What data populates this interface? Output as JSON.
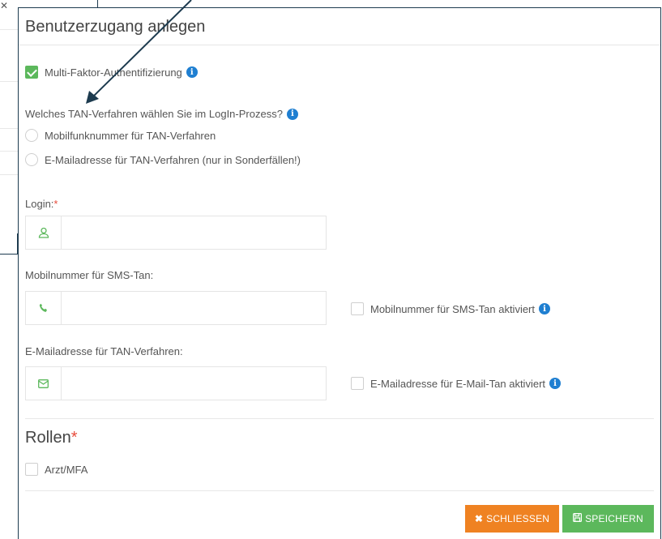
{
  "dialog": {
    "title": "Benutzerzugang anlegen",
    "mfa": {
      "label": "Multi-Faktor-Authentifizierung",
      "checked": true,
      "info_icon": "info-circle-icon"
    },
    "tan_question": "Welches TAN-Verfahren wählen Sie im LogIn-Prozess?",
    "tan_options": [
      {
        "label": "Mobilfunknummer für TAN-Verfahren",
        "selected": false
      },
      {
        "label": "E-Mailadresse für TAN-Verfahren (nur in Sonderfällen!)",
        "selected": false
      }
    ],
    "login": {
      "label": "Login:",
      "required_mark": "*",
      "value": "",
      "icon": "user-icon"
    },
    "mobile": {
      "label": "Mobilnummer für SMS-Tan:",
      "value": "",
      "icon": "phone-icon",
      "activated_label": "Mobilnummer für SMS-Tan aktiviert",
      "activated": false
    },
    "email": {
      "label": "E-Mailadresse für TAN-Verfahren:",
      "value": "",
      "icon": "envelope-icon",
      "activated_label": "E-Mailadresse für E-Mail-Tan aktiviert",
      "activated": false
    },
    "roles": {
      "title": "Rollen",
      "required_mark": "*",
      "items": [
        {
          "label": "Arzt/MFA",
          "checked": false
        }
      ]
    },
    "buttons": {
      "close": "SCHLIESSEN",
      "save": "SPEICHERN"
    },
    "colors": {
      "accent_green": "#5cb85c",
      "close_orange": "#ef8222",
      "info_blue": "#1f7fd1",
      "required_red": "#e74c3c"
    }
  }
}
